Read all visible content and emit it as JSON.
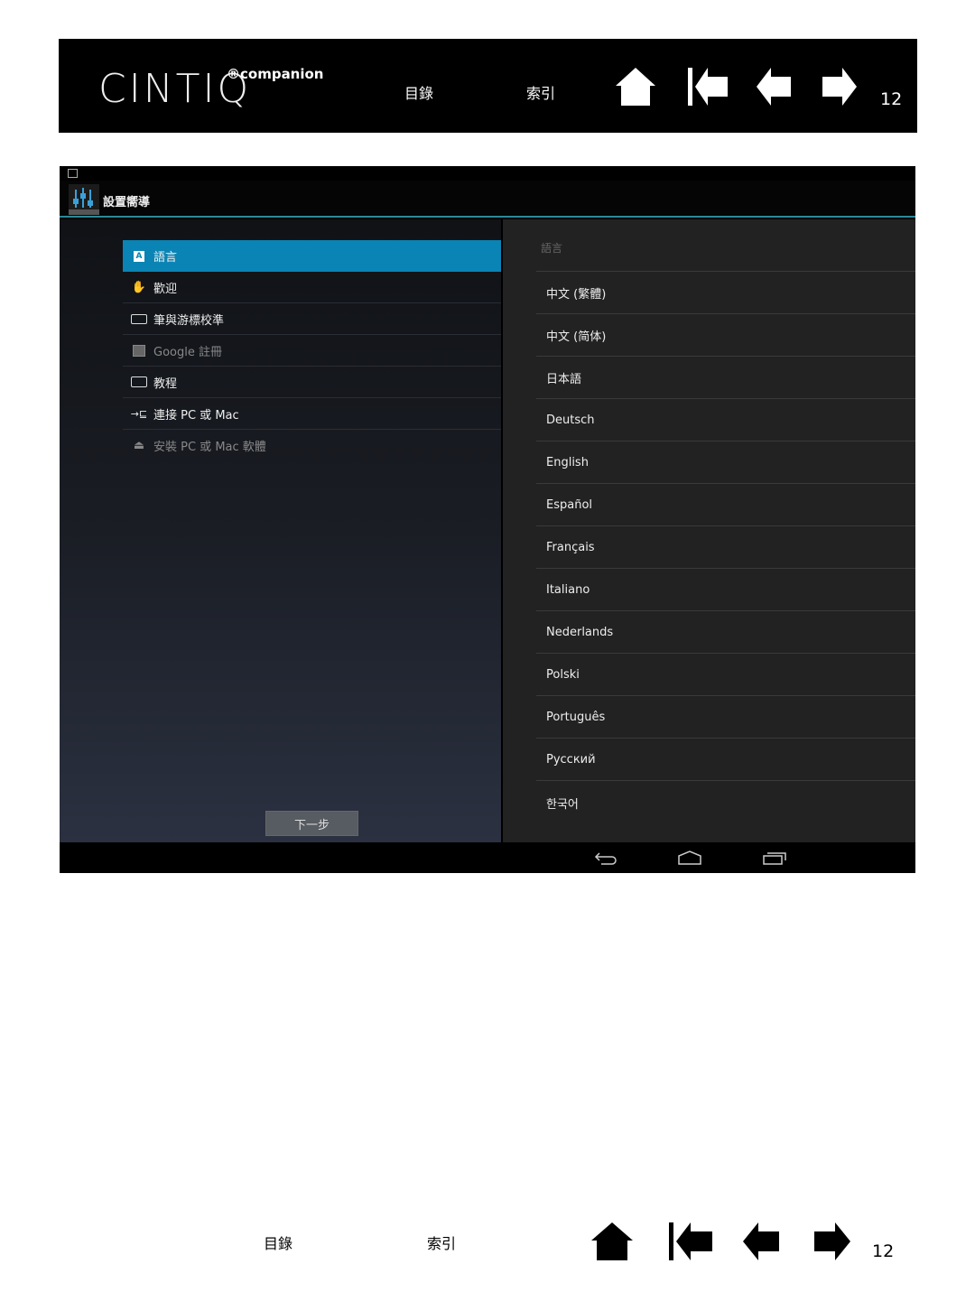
{
  "header": {
    "logo": "CINTIQ",
    "logo_sub": "®companion",
    "toc_label": "目錄",
    "index_label": "索引",
    "page_number": "12",
    "icons": [
      "home-icon",
      "first-page-icon",
      "previous-page-icon",
      "next-page-icon"
    ]
  },
  "app": {
    "title": "設置嚮導",
    "menu": [
      {
        "label": "語言",
        "icon": "language-icon",
        "selected": true
      },
      {
        "label": "歡迎",
        "icon": "wave-hand-icon"
      },
      {
        "label": "筆與游標校準",
        "icon": "tablet-pen-icon"
      },
      {
        "label": "Google 註冊",
        "icon": "image-icon",
        "disabled": true
      },
      {
        "label": "教程",
        "icon": "monitor-icon"
      },
      {
        "label": "連接 PC 或 Mac",
        "icon": "connect-icon"
      },
      {
        "label": "安裝 PC 或 Mac 軟體",
        "icon": "install-icon",
        "disabled": true
      }
    ],
    "next_button": "下一步",
    "list_header": "語言",
    "languages": [
      "中文 (繁體)",
      "中文 (简体)",
      "日本語",
      "Deutsch",
      "English",
      "Español",
      "Français",
      "Italiano",
      "Nederlands",
      "Polski",
      "Português",
      "Русский",
      "한국어"
    ],
    "accent_color": "#0a84b4"
  },
  "footer": {
    "toc_label": "目錄",
    "index_label": "索引",
    "page_number": "12"
  }
}
